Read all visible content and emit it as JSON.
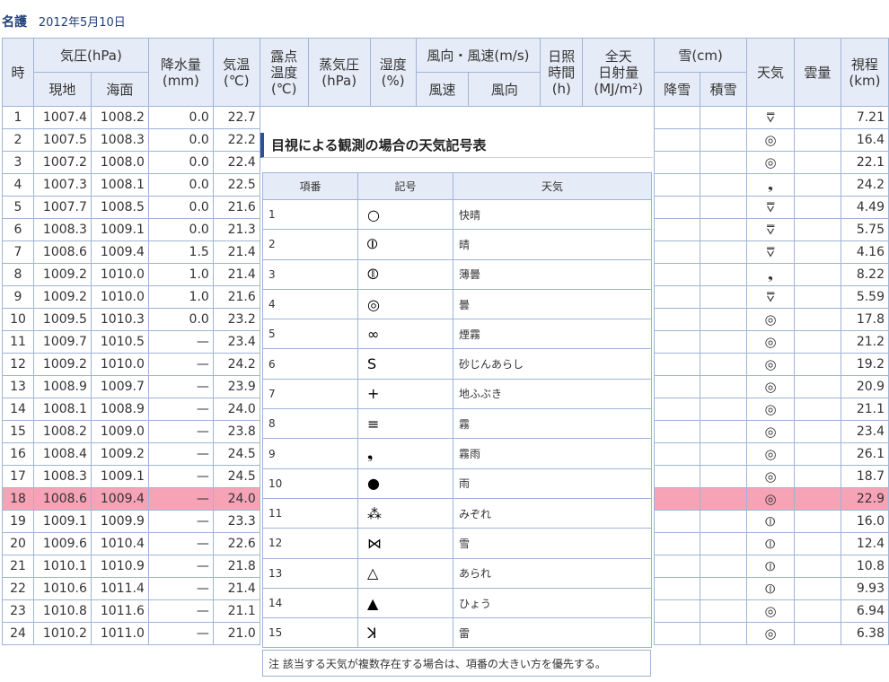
{
  "page": {
    "station": "名護",
    "date": "2012年5月10日"
  },
  "headers": {
    "hour": "時",
    "pressure": "気圧(hPa)",
    "pressure_local": "現地",
    "pressure_sea": "海面",
    "precip": "降水量\n(mm)",
    "temp": "気温\n(℃)",
    "dew": "露点\n温度\n(℃)",
    "vapor": "蒸気圧\n(hPa)",
    "humidity": "湿度\n(%)",
    "wind": "風向・風速(m/s)",
    "wind_speed": "風速",
    "wind_dir": "風向",
    "sunshine": "日照\n時間\n(h)",
    "solar": "全天\n日射量\n(MJ/m²)",
    "snow": "雪(cm)",
    "snowfall": "降雪",
    "snowdepth": "積雪",
    "weather": "天気",
    "cloud": "雲量",
    "visibility": "視程\n(km)"
  },
  "rows": [
    {
      "hour": "1",
      "local": "1007.4",
      "sea": "1008.2",
      "precip": "0.0",
      "temp": "22.7",
      "weather": "⩢",
      "vis": "7.21"
    },
    {
      "hour": "2",
      "local": "1007.5",
      "sea": "1008.3",
      "precip": "0.0",
      "temp": "22.2",
      "weather": "◎",
      "vis": "16.4"
    },
    {
      "hour": "3",
      "local": "1007.2",
      "sea": "1008.0",
      "precip": "0.0",
      "temp": "22.4",
      "weather": "◎",
      "vis": "22.1"
    },
    {
      "hour": "4",
      "local": "1007.3",
      "sea": "1008.1",
      "precip": "0.0",
      "temp": "22.5",
      "weather": "❟",
      "vis": "24.2"
    },
    {
      "hour": "5",
      "local": "1007.7",
      "sea": "1008.5",
      "precip": "0.0",
      "temp": "21.6",
      "weather": "⩢",
      "vis": "4.49"
    },
    {
      "hour": "6",
      "local": "1008.3",
      "sea": "1009.1",
      "precip": "0.0",
      "temp": "21.3",
      "weather": "⩢",
      "vis": "5.75"
    },
    {
      "hour": "7",
      "local": "1008.6",
      "sea": "1009.4",
      "precip": "1.5",
      "temp": "21.4",
      "weather": "⩢",
      "vis": "4.16"
    },
    {
      "hour": "8",
      "local": "1009.2",
      "sea": "1010.0",
      "precip": "1.0",
      "temp": "21.4",
      "weather": "❟",
      "vis": "8.22"
    },
    {
      "hour": "9",
      "local": "1009.2",
      "sea": "1010.0",
      "precip": "1.0",
      "temp": "21.6",
      "weather": "⩢",
      "vis": "5.59"
    },
    {
      "hour": "10",
      "local": "1009.5",
      "sea": "1010.3",
      "precip": "0.0",
      "temp": "23.2",
      "weather": "◎",
      "vis": "17.8"
    },
    {
      "hour": "11",
      "local": "1009.7",
      "sea": "1010.5",
      "precip": "—",
      "temp": "23.4",
      "weather": "◎",
      "vis": "21.2"
    },
    {
      "hour": "12",
      "local": "1009.2",
      "sea": "1010.0",
      "precip": "—",
      "temp": "24.2",
      "weather": "◎",
      "vis": "19.2"
    },
    {
      "hour": "13",
      "local": "1008.9",
      "sea": "1009.7",
      "precip": "—",
      "temp": "23.9",
      "weather": "◎",
      "vis": "20.9"
    },
    {
      "hour": "14",
      "local": "1008.1",
      "sea": "1008.9",
      "precip": "—",
      "temp": "24.0",
      "weather": "◎",
      "vis": "21.1"
    },
    {
      "hour": "15",
      "local": "1008.2",
      "sea": "1009.0",
      "precip": "—",
      "temp": "23.8",
      "weather": "◎",
      "vis": "23.4"
    },
    {
      "hour": "16",
      "local": "1008.4",
      "sea": "1009.2",
      "precip": "—",
      "temp": "24.5",
      "weather": "◎",
      "vis": "26.1"
    },
    {
      "hour": "17",
      "local": "1008.3",
      "sea": "1009.1",
      "precip": "—",
      "temp": "24.5",
      "weather": "◎",
      "vis": "18.7"
    },
    {
      "hour": "18",
      "local": "1008.6",
      "sea": "1009.4",
      "precip": "—",
      "temp": "24.0",
      "weather": "◎",
      "vis": "22.9"
    },
    {
      "hour": "19",
      "local": "1009.1",
      "sea": "1009.9",
      "precip": "—",
      "temp": "23.3",
      "weather": "⦶",
      "vis": "16.0"
    },
    {
      "hour": "20",
      "local": "1009.6",
      "sea": "1010.4",
      "precip": "—",
      "temp": "22.6",
      "weather": "⦶",
      "vis": "12.4"
    },
    {
      "hour": "21",
      "local": "1010.1",
      "sea": "1010.9",
      "precip": "—",
      "temp": "21.8",
      "weather": "⦶",
      "vis": "10.8"
    },
    {
      "hour": "22",
      "local": "1010.6",
      "sea": "1011.4",
      "precip": "—",
      "temp": "21.4",
      "weather": "⦶",
      "vis": "9.93"
    },
    {
      "hour": "23",
      "local": "1010.8",
      "sea": "1011.6",
      "precip": "—",
      "temp": "21.1",
      "weather": "◎",
      "vis": "6.94"
    },
    {
      "hour": "24",
      "local": "1010.2",
      "sea": "1011.0",
      "precip": "—",
      "temp": "21.0",
      "weather": "◎",
      "vis": "6.38"
    }
  ],
  "highlight_hour": "18",
  "highlight_color": "#f6a3b6",
  "legend": {
    "title": "目視による観測の場合の天気記号表",
    "headers": {
      "num": "項番",
      "symbol": "記号",
      "weather": "天気"
    },
    "items": [
      {
        "num": "1",
        "symbol": "○",
        "name": "快晴"
      },
      {
        "num": "2",
        "symbol": "⦶",
        "name": "晴"
      },
      {
        "num": "3",
        "symbol": "⦷",
        "name": "薄曇"
      },
      {
        "num": "4",
        "symbol": "◎",
        "name": "曇"
      },
      {
        "num": "5",
        "symbol": "∞",
        "name": "煙霧"
      },
      {
        "num": "6",
        "symbol": "S",
        "name": "砂じんあらし"
      },
      {
        "num": "7",
        "symbol": "+",
        "name": "地ふぶき"
      },
      {
        "num": "8",
        "symbol": "≡",
        "name": "霧"
      },
      {
        "num": "9",
        "symbol": "❟",
        "name": "霧雨"
      },
      {
        "num": "10",
        "symbol": "●",
        "name": "雨"
      },
      {
        "num": "11",
        "symbol": "⁂",
        "name": "みぞれ"
      },
      {
        "num": "12",
        "symbol": "⋈",
        "name": "雪"
      },
      {
        "num": "13",
        "symbol": "△",
        "name": "あられ"
      },
      {
        "num": "14",
        "symbol": "▲",
        "name": "ひょう"
      },
      {
        "num": "15",
        "symbol": "ꓘ",
        "name": "雷"
      }
    ],
    "note": "注  該当する天気が複数存在する場合は、項番の大きい方を優先する。"
  }
}
